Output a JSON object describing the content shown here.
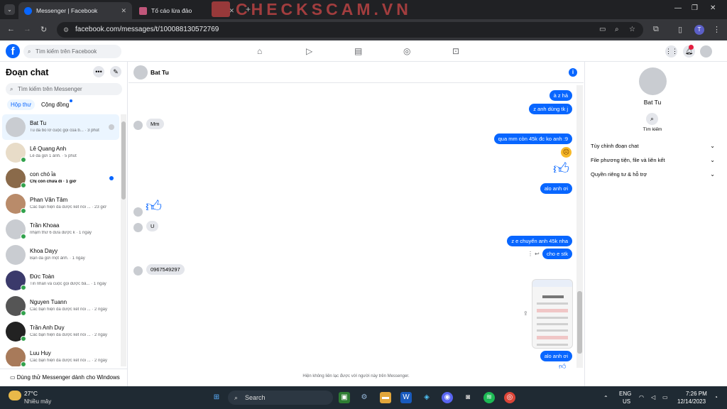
{
  "browser": {
    "tabs": [
      {
        "title": "Messenger | Facebook",
        "active": true
      },
      {
        "title": "Tố cáo lừa đảo",
        "active": false
      }
    ],
    "url": "facebook.com/messages/t/100088130572769",
    "watermark": "CHECKSCAM.VN",
    "profile_initial": "T"
  },
  "facebook": {
    "logo": "f",
    "search_placeholder": "Tìm kiếm trên Facebook",
    "brand_color": "#0866ff"
  },
  "left": {
    "title": "Đoạn chat",
    "search_placeholder": "Tìm kiếm trên Messenger",
    "tabs": [
      "Hộp thư",
      "Cộng đồng"
    ],
    "chats": [
      {
        "name": "Bat Tu",
        "preview": "Tu đã bỏ lỡ cuộc gọi của b... · 3 phút"
      },
      {
        "name": "Lê Quang Anh",
        "preview": "Lê đã gửi 1 ảnh. · 5 phút"
      },
      {
        "name": "con chó ỉa",
        "preview": "Chị còn chưa đi · 1 giờ"
      },
      {
        "name": "Phan Văn Tâm",
        "preview": "Các bạn hiện đã được kết nối ... · 23 giờ"
      },
      {
        "name": "Trần Khoaa",
        "preview": "nhậm thứ 6 đưa được k · 1 ngày"
      },
      {
        "name": "Khoa Dayy",
        "preview": "Bạn đã gửi một ảnh. · 1 ngày"
      },
      {
        "name": "Đức Toàn",
        "preview": "Tin nhắn và cuộc gọi được bả... · 1 ngày"
      },
      {
        "name": "Nguyen Tuann",
        "preview": "Các bạn hiện đã được kết nối ... · 2 ngày"
      },
      {
        "name": "Trần Anh Duy",
        "preview": "Các bạn hiện đã được kết nối ... · 2 ngày"
      },
      {
        "name": "Luu Huy",
        "preview": "Các bạn hiện đã được kết nối ... · 2 ngày"
      }
    ],
    "try_windows": "Dùng thử Messenger dành cho Windows"
  },
  "conversation": {
    "name": "Bat Tu",
    "messages": {
      "m1": "à z hả",
      "m2": "z anh dùng tk j",
      "m3": "Mm",
      "m4": "qua mm còn 45k đc ko anh :9",
      "m5": "alo anh ơi",
      "m6": "U",
      "m7": "z e chuyển anh 45k nha",
      "m8": "cho e stk",
      "m9": "0967549297",
      "m10": "alo anh ơi"
    },
    "footer": "Hiện không liên lạc được với người này trên Messenger."
  },
  "right": {
    "name": "Bat Tu",
    "search_label": "Tìm kiếm",
    "sections": [
      "Tùy chỉnh đoạn chat",
      "File phương tiện, file và liên kết",
      "Quyền riêng tư & hỗ trợ"
    ]
  },
  "taskbar": {
    "temperature": "27°C",
    "weather": "Nhiều mây",
    "search": "Search",
    "lang1": "ENG",
    "lang2": "US",
    "time": "7:26 PM",
    "date": "12/14/2023"
  }
}
